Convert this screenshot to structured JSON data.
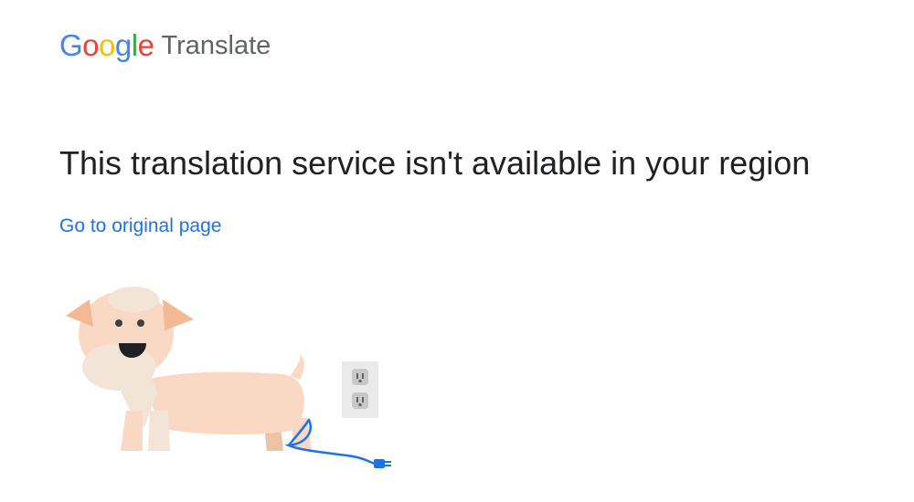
{
  "header": {
    "logo_letters": [
      "G",
      "o",
      "o",
      "g",
      "l",
      "e"
    ],
    "logo_colors": [
      "#4285F4",
      "#EA4335",
      "#FBBC05",
      "#4285F4",
      "#34A853",
      "#EA4335"
    ],
    "product_name": "Translate"
  },
  "main": {
    "headline": "This translation service isn't available in your region",
    "link_text": "Go to original page",
    "illustration": {
      "subject": "dog-with-unplugged-cable",
      "icons": [
        "dog-icon",
        "wall-outlet-icon",
        "plug-icon"
      ]
    }
  },
  "colors": {
    "link": "#1a73e8",
    "text": "#202124",
    "product_name": "#5f6368",
    "dog_body": "#f9d9c3",
    "dog_ear": "#f2b995",
    "outlet": "#e8e8e8",
    "cable": "#1a73e8"
  }
}
